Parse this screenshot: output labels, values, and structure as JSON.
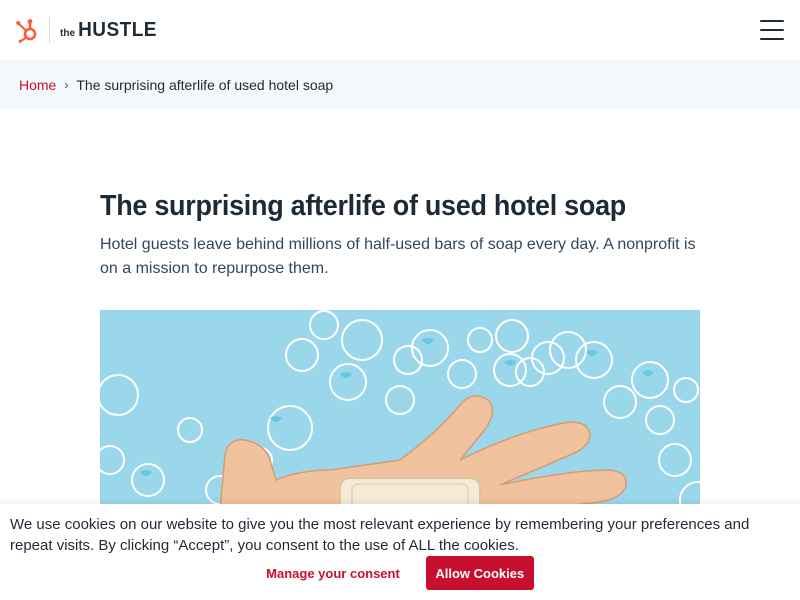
{
  "header": {
    "logo_icon": "hubspot-sprocket-icon",
    "brand_prefix": "the",
    "brand_name": "HUSTLE",
    "menu_icon": "hamburger-menu-icon",
    "accent": "#ff5c35"
  },
  "breadcrumb": {
    "home": "Home",
    "separator": "›",
    "current": "The surprising afterlife of used hotel soap"
  },
  "article": {
    "title": "The surprising afterlife of used hotel soap",
    "subtitle": "Hotel guests leave behind millions of half-used bars of soap every day. A nonprofit is on a mission to repurpose them.",
    "hero_image_background": "#9ad7ea"
  },
  "cookie_banner": {
    "text": "We use cookies on our website to give you the most relevant experience by remembering your preferences and repeat visits. By clicking “Accept”, you consent to the use of ALL the cookies.",
    "manage_label": "Manage your consent",
    "allow_label": "Allow Cookies",
    "accent": "#c8102e"
  }
}
